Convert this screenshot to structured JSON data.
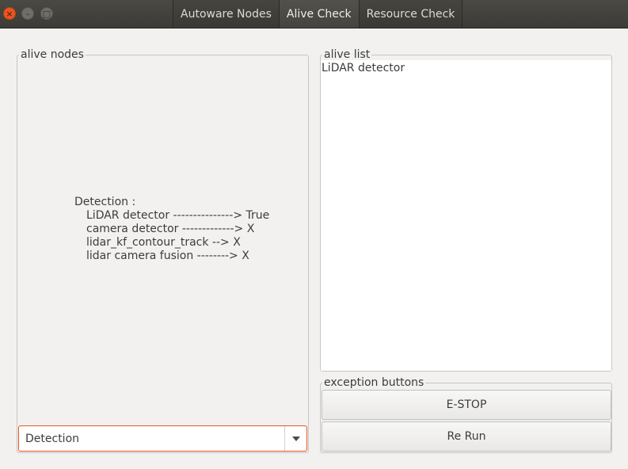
{
  "window": {
    "close_glyph": "×",
    "minimize_glyph": "–",
    "maximize_glyph": "□"
  },
  "tabs": [
    {
      "label": "Autoware Nodes"
    },
    {
      "label": "Alive Check"
    },
    {
      "label": "Resource Check"
    }
  ],
  "alive_nodes": {
    "title": "alive nodes",
    "detection_header": "Detection :",
    "lines": [
      "LiDAR detector ---------------> True",
      "camera detector -------------> X",
      "lidar_kf_contour_track --> X",
      "lidar camera fusion --------> X"
    ],
    "combo_value": "Detection"
  },
  "alive_list": {
    "title": "alive list",
    "items": [
      "LiDAR detector"
    ]
  },
  "exception_buttons": {
    "title": "exception buttons",
    "estop_label": "E-STOP",
    "rerun_label": "Re Run"
  },
  "colors": {
    "accent": "#e95420",
    "titlebar": "#3c3b37",
    "window_bg": "#f2f1f0"
  }
}
